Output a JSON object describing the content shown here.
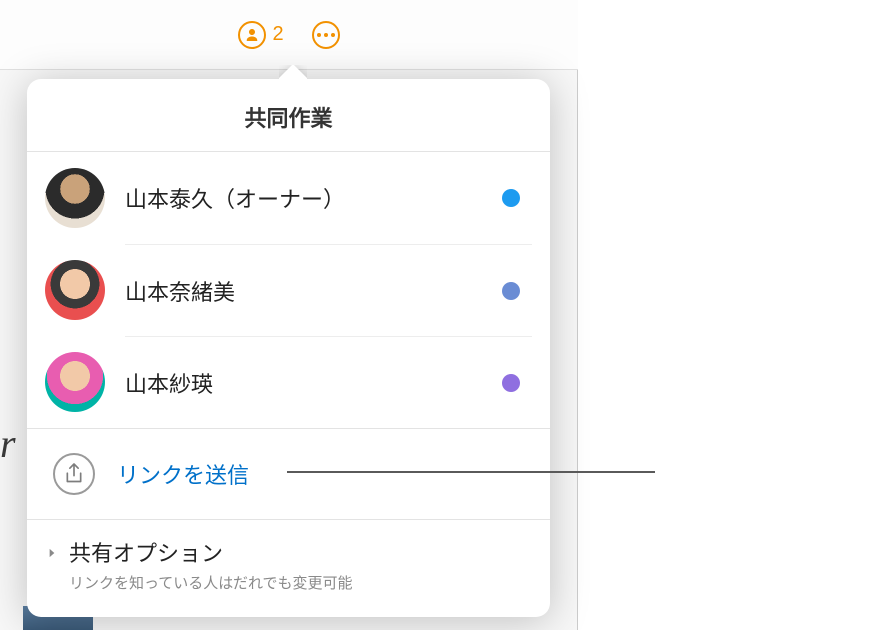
{
  "toolbar": {
    "collaborator_count": "2"
  },
  "popover": {
    "title": "共同作業",
    "participants": [
      {
        "name": "山本泰久（オーナー）",
        "status_color": "#1d9bf0"
      },
      {
        "name": "山本奈緒美",
        "status_color": "#6a8cd4"
      },
      {
        "name": "山本紗瑛",
        "status_color": "#8f6fe0"
      }
    ],
    "send_link_label": "リンクを送信",
    "share_options": {
      "title": "共有オプション",
      "subtitle": "リンクを知っている人はだれでも変更可能"
    }
  }
}
